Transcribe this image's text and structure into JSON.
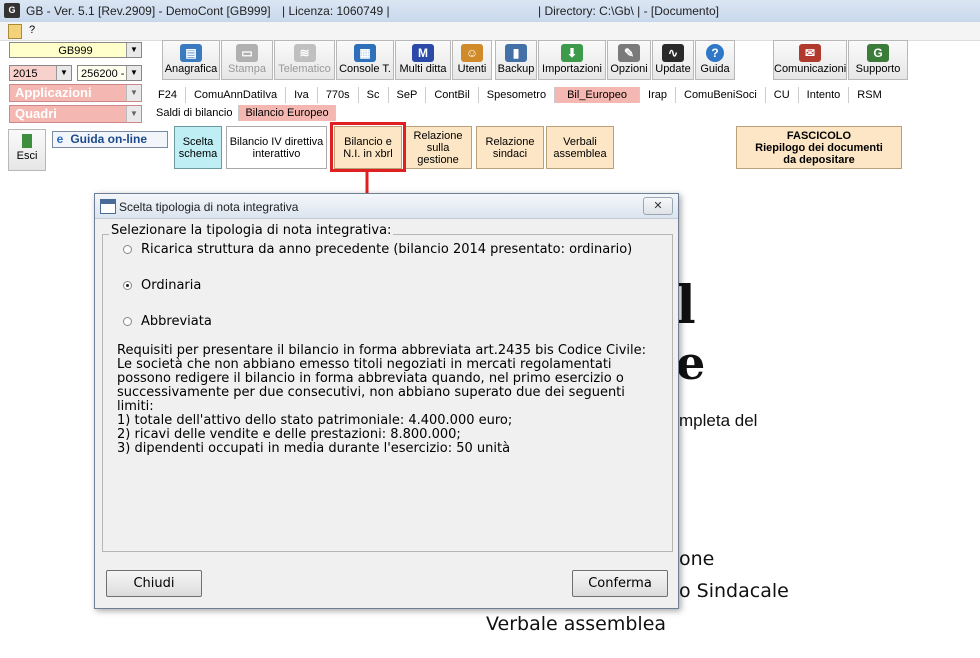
{
  "titlebar": {
    "app": "GB - Ver. 5.1 [Rev.2909] - DemoCont [GB999]",
    "license": "| Licenza: 1060749 |",
    "directory": "| Directory: C:\\Gb\\ | - [Documento]"
  },
  "menu": {
    "help": "?"
  },
  "left": {
    "company": "GB999",
    "year": "2015",
    "code": "256200 -",
    "applicazioni": "Applicazioni",
    "quadri": "Quadri"
  },
  "toolbar": [
    {
      "label": "Anagrafica",
      "icon": "book-icon",
      "color": "#3a7bbf"
    },
    {
      "label": "Stampa",
      "icon": "printer-icon",
      "color": "#b0b0b0",
      "disabled": true
    },
    {
      "label": "Telematico",
      "icon": "telematic-icon",
      "color": "#c0c0c0",
      "disabled": true
    },
    {
      "label": "Console T.",
      "icon": "console-icon",
      "color": "#2d6fb8"
    },
    {
      "label": "Multi ditta",
      "icon": "m-icon",
      "color": "#2b4aa8"
    },
    {
      "label": "Utenti",
      "icon": "users-icon",
      "color": "#d08a2a"
    },
    {
      "label": "Backup",
      "icon": "backup-icon",
      "color": "#4470a8"
    },
    {
      "label": "Importazioni",
      "icon": "import-icon",
      "color": "#3d9a4a"
    },
    {
      "label": "Opzioni",
      "icon": "wrench-icon",
      "color": "#7a7a7a"
    },
    {
      "label": "Update",
      "icon": "update-icon",
      "color": "#2a2a2a"
    },
    {
      "label": "Guida",
      "icon": "help-icon",
      "color": "#2f78c8"
    },
    {
      "label": "Comunicazioni",
      "icon": "comunicazioni-icon",
      "color": "#b03a2e"
    },
    {
      "label": "Supporto",
      "icon": "support-icon",
      "color": "#3b7c3b"
    }
  ],
  "tabs_row1": [
    "F24",
    "ComuAnnDatiIva",
    "Iva",
    "770s",
    "Sc",
    "SeP",
    "ContBil",
    "Spesometro",
    "Bil_Europeo",
    "Irap",
    "ComuBeniSoci",
    "CU",
    "Intento",
    "RSM"
  ],
  "tabs_row1_active": "Bil_Europeo",
  "tabs_row2": [
    "Saldi di bilancio",
    "Bilancio Europeo"
  ],
  "tabs_row2_active": "Bilancio Europeo",
  "exit_label": "Esci",
  "guide_label": "Guida on-line",
  "actions": {
    "scelta": "Scelta schema",
    "bilancio4": "Bilancio IV direttiva interattivo",
    "nixbrl": "Bilancio e N.I. in xbrl",
    "relazione_gestione": "Relazione sulla gestione",
    "relazione_sindaci": "Relazione sindaci",
    "verbali": "Verbali assemblea"
  },
  "fascicolo": {
    "line1": "FASCICOLO",
    "line2": "Riepilogo dei documenti",
    "line3": "da depositare"
  },
  "background": {
    "big1": "l",
    "big2": "e",
    "mpleta": "mpleta del",
    "one": "one",
    "sindacale": "o Sindacale",
    "verbale": "Verbale assemblea"
  },
  "dialog": {
    "title": "Scelta tipologia di nota integrativa",
    "close": "✕",
    "group_label": "Selezionare la tipologia di nota integrativa:",
    "options": [
      {
        "label": "Ricarica struttura da anno precedente (bilancio 2014 presentato: ordinario)",
        "selected": false
      },
      {
        "label": "Ordinaria",
        "selected": true
      },
      {
        "label": "Abbreviata",
        "selected": false
      }
    ],
    "requirements": [
      "Requisiti per presentare il bilancio in forma abbreviata art.2435 bis Codice Civile:",
      "Le società che non abbiano emesso titoli negoziati in mercati regolamentati",
      "possono redigere il bilancio in forma abbreviata quando, nel primo esercizio o",
      "successivamente per due consecutivi, non abbiano superato due dei seguenti",
      "limiti:",
      "1) totale dell'attivo dello stato patrimoniale: 4.400.000 euro;",
      "2) ricavi delle vendite e delle prestazioni: 8.800.000;",
      "3) dipendenti occupati in media durante l'esercizio: 50 unità"
    ],
    "cancel": "Chiudi",
    "confirm": "Conferma"
  },
  "colors": {
    "accent_red": "#e02020",
    "pink": "#f5b7b1",
    "peach": "#fde6c5",
    "selected_teal": "#bfeff4"
  }
}
